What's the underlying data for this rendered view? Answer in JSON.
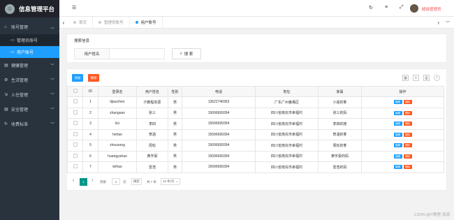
{
  "app": {
    "title": "信息管理平台",
    "user": "超级管理员"
  },
  "sidebar": {
    "items": [
      {
        "label": "账号管理",
        "icon": "home-icon"
      },
      {
        "label": "管理员账号",
        "icon": "monitor-icon"
      },
      {
        "label": "用户账号",
        "icon": "monitor-icon"
      },
      {
        "label": "健康管理",
        "icon": "folder-icon"
      },
      {
        "label": "生活管理",
        "icon": "gear-icon"
      },
      {
        "label": "入住管理",
        "icon": "import-icon"
      },
      {
        "label": "安全管理",
        "icon": "folder-icon"
      },
      {
        "label": "收费标准",
        "icon": "refresh-icon"
      }
    ]
  },
  "tabs": [
    "首页",
    "管理员账号",
    "用户账号"
  ],
  "search": {
    "section_title": "搜索信息",
    "field_label": "用户姓名",
    "button": "搜 索"
  },
  "toolbar": {
    "add": "添加",
    "delete": "删除"
  },
  "table": {
    "headers": [
      "ID",
      "登录名",
      "用户姓名",
      "性别",
      "电话",
      "地址",
      "家属",
      "操作"
    ],
    "edit": "编辑",
    "del": "删除",
    "rows": [
      [
        "1",
        "itjiaochen",
        "IT教程资源",
        "男",
        "13622746953",
        "广东广州番禺区",
        "小强的爹"
      ],
      [
        "2",
        "zhangsan",
        "张三",
        "男",
        "15696699394",
        "四川省南充市幸福村",
        "张三的妈"
      ],
      [
        "3",
        "lisi",
        "李四",
        "男",
        "15696699394",
        "四川省南充市幸福村",
        "李四的姥"
      ],
      [
        "4",
        "hehan",
        "贺涵",
        "男",
        "15696699394",
        "四川省南充市幸福村",
        "贺涵的爹"
      ],
      [
        "5",
        "zhousong",
        "周松",
        "男",
        "15696699394",
        "四川省南充市幸福村",
        "周松的爹"
      ],
      [
        "6",
        "huangyuhao",
        "黄宇豪",
        "男",
        "15696699394",
        "四川省南充市幸福村",
        "黄宇豪的妈"
      ],
      [
        "7",
        "leihao",
        "雷浩",
        "男",
        "15696699394",
        "四川省南充市幸福村",
        "雷浩的妈"
      ]
    ]
  },
  "pager": {
    "current": "1",
    "goto": "到第",
    "page_value": "1",
    "page_unit": "页",
    "confirm": "确定",
    "total": "共 7 条",
    "size": "10 条/页"
  },
  "watermark": "CSDN @IT教程-资源"
}
